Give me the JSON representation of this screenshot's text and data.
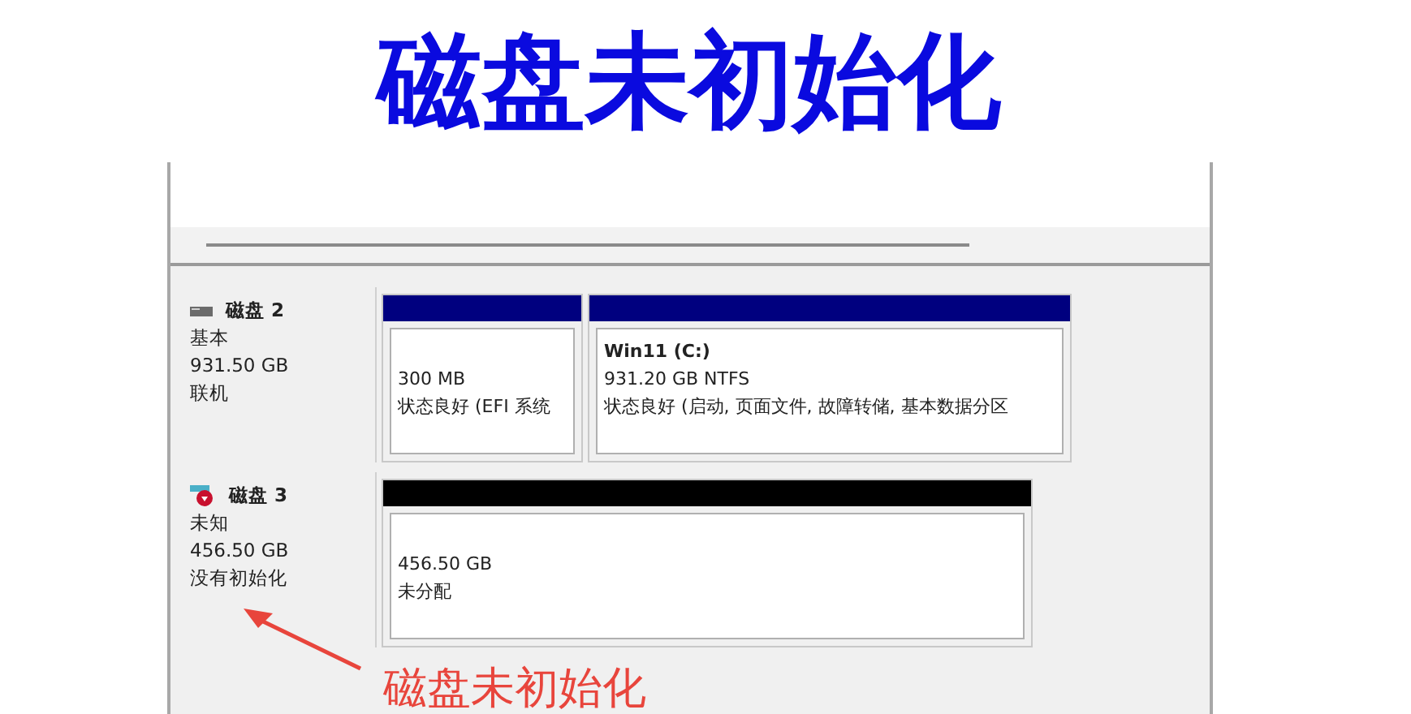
{
  "title": "磁盘未初始化",
  "disks": [
    {
      "name": "磁盘 2",
      "type": "基本",
      "size": "931.50 GB",
      "status": "联机",
      "kind": "basic",
      "partitions": [
        {
          "size": "300 MB",
          "status": "状态良好 (EFI 系统",
          "kind": "primary"
        },
        {
          "label": "Win11  (C:)",
          "size": "931.20 GB NTFS",
          "status": "状态良好 (启动, 页面文件, 故障转储, 基本数据分区",
          "kind": "primary"
        }
      ]
    },
    {
      "name": "磁盘 3",
      "type": "未知",
      "size": "456.50 GB",
      "status": "没有初始化",
      "kind": "uninitialized",
      "partitions": [
        {
          "size": "456.50 GB",
          "status": "未分配",
          "kind": "unallocated"
        }
      ]
    }
  ],
  "annotation": "磁盘未初始化"
}
